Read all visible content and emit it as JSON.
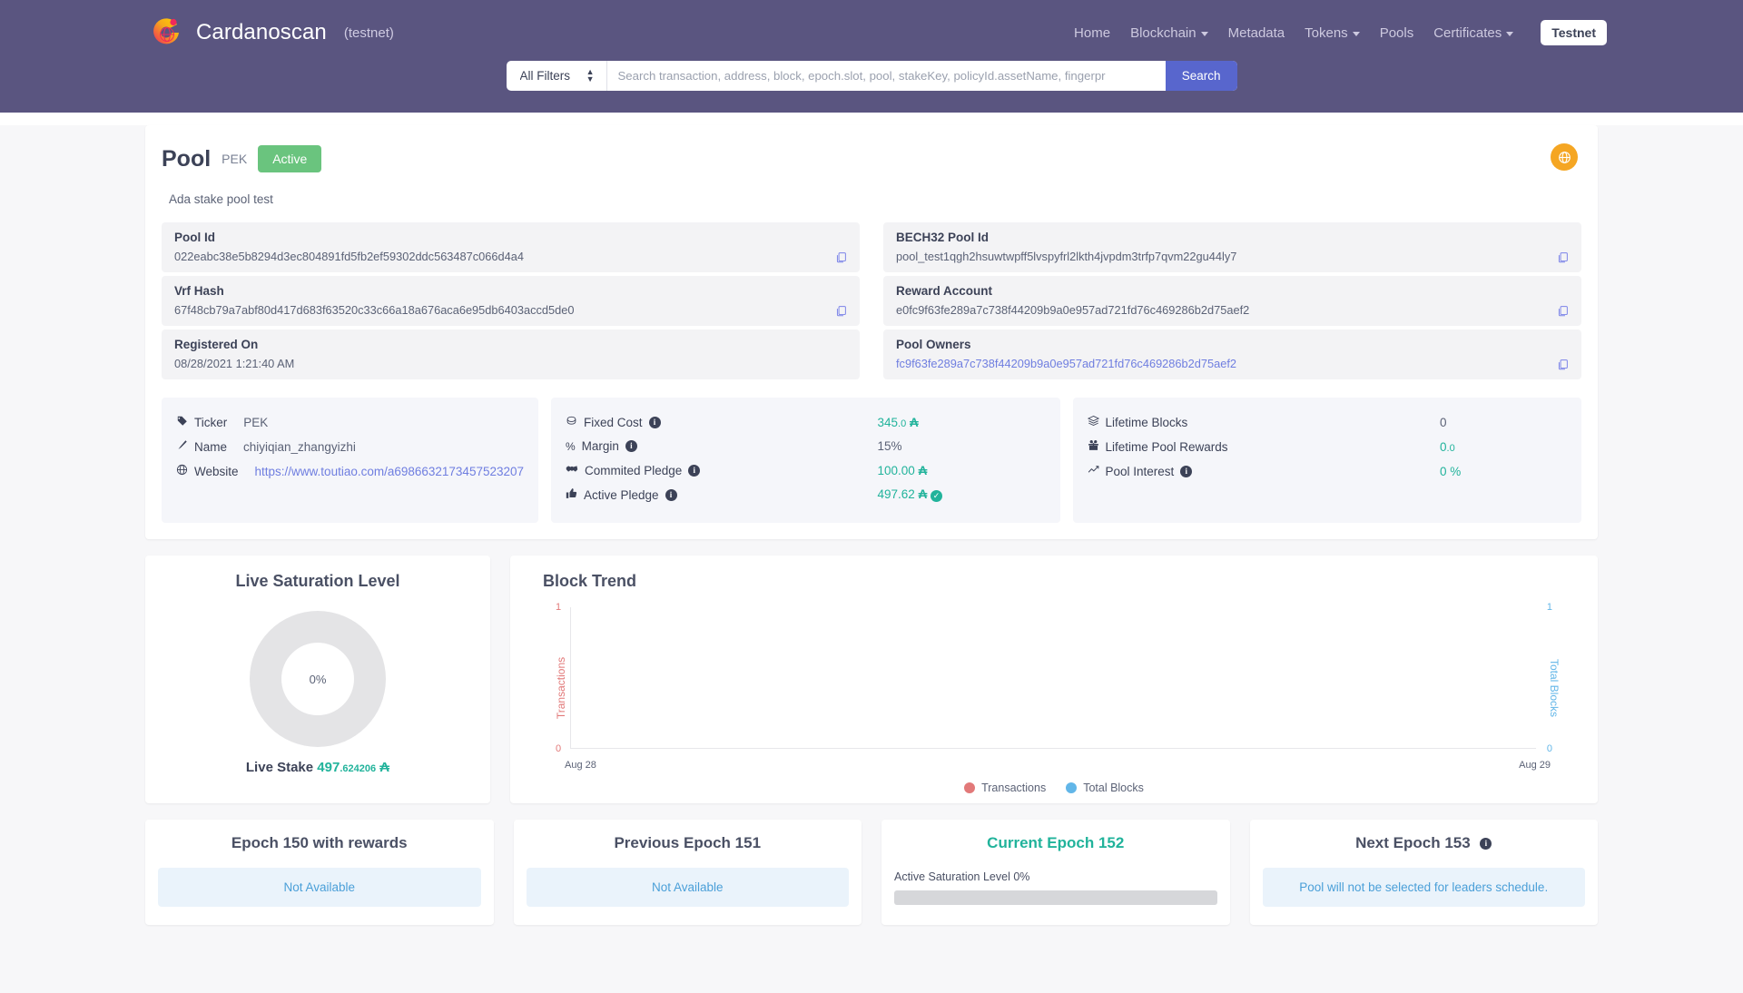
{
  "header": {
    "brand": "Cardanoscan",
    "brand_sub": "(testnet)",
    "nav": [
      {
        "label": "Home",
        "caret": false
      },
      {
        "label": "Blockchain",
        "caret": true
      },
      {
        "label": "Metadata",
        "caret": false
      },
      {
        "label": "Tokens",
        "caret": true
      },
      {
        "label": "Pools",
        "caret": false
      },
      {
        "label": "Certificates",
        "caret": true
      }
    ],
    "network_button": "Testnet"
  },
  "search": {
    "filter_value": "All Filters",
    "placeholder": "Search transaction, address, block, epoch.slot, pool, stakeKey, policyId.assetName, fingerpr",
    "input_value": "",
    "button": "Search"
  },
  "pool": {
    "title": "Pool",
    "ticker_tag": "PEK",
    "status": "Active",
    "description": "Ada stake pool test",
    "fields_left": [
      {
        "label": "Pool Id",
        "value": "022eabc38e5b8294d3ec804891fd5fb2ef59302ddc563487c066d4a4",
        "copy": true,
        "link": false
      },
      {
        "label": "Vrf Hash",
        "value": "67f48cb79a7abf80d417d683f63520c33c66a18a676aca6e95db6403accd5de0",
        "copy": true,
        "link": false
      },
      {
        "label": "Registered On",
        "value": "08/28/2021 1:21:40 AM",
        "copy": false,
        "link": false
      }
    ],
    "fields_right": [
      {
        "label": "BECH32 Pool Id",
        "value": "pool_test1qgh2hsuwtwpff5lvspyfrl2lkth4jvpdm3trfp7qvm22gu44ly7",
        "copy": true,
        "link": false
      },
      {
        "label": "Reward Account",
        "value": "e0fc9f63fe289a7c738f44209b9a0e957ad721fd76c469286b2d75aef2",
        "copy": true,
        "link": false
      },
      {
        "label": "Pool Owners",
        "value": "fc9f63fe289a7c738f44209b9a0e957ad721fd76c469286b2d75aef2",
        "copy": true,
        "link": true
      }
    ],
    "panel1": [
      {
        "icon": "tag-icon",
        "label": "Ticker",
        "value": "PEK",
        "link": false
      },
      {
        "icon": "pen-icon",
        "label": "Name",
        "value": "chiyiqian_zhangyizhi",
        "link": false
      },
      {
        "icon": "globe-icon",
        "label": "Website",
        "value": "https://www.toutiao.com/a6986632173457523207",
        "link": true
      }
    ],
    "panel2": [
      {
        "icon": "coin-icon",
        "label": "Fixed Cost",
        "info": true,
        "value": "345",
        "decimal": ".0",
        "ada": true,
        "check": false
      },
      {
        "icon": "percent-icon",
        "label": "Margin",
        "info": true,
        "value": "15%",
        "decimal": "",
        "ada": false,
        "check": false
      },
      {
        "icon": "handshake-icon",
        "label": "Commited Pledge",
        "info": true,
        "value": "100.00",
        "decimal": "",
        "ada": true,
        "check": false
      },
      {
        "icon": "thumbsup-icon",
        "label": "Active Pledge",
        "info": true,
        "value": "497.62",
        "decimal": "",
        "ada": true,
        "check": true
      }
    ],
    "panel3": [
      {
        "icon": "layers-icon",
        "label": "Lifetime Blocks",
        "info": false,
        "value": "0",
        "decimal": "",
        "teal": false
      },
      {
        "icon": "gift-icon",
        "label": "Lifetime Pool Rewards",
        "info": false,
        "value": "0",
        "decimal": ".0",
        "teal": true
      },
      {
        "icon": "chart-icon",
        "label": "Pool Interest",
        "info": true,
        "value": "0 %",
        "decimal": "",
        "teal": true
      }
    ]
  },
  "chart_data": [
    {
      "type": "pie",
      "title": "Live Saturation Level",
      "center_label": "0%",
      "slices": [
        {
          "name": "Saturation",
          "value": 0,
          "color": "#e4e4e6"
        }
      ],
      "footer_label": "Live Stake",
      "footer_value": "497",
      "footer_decimal": ".624206"
    },
    {
      "type": "line",
      "title": "Block Trend",
      "x": [
        "Aug 28",
        "Aug 29"
      ],
      "series": [
        {
          "name": "Transactions",
          "values": [
            0,
            0
          ],
          "color": "#e27979",
          "axis": "left"
        },
        {
          "name": "Total Blocks",
          "values": [
            0,
            0
          ],
          "color": "#62b6e8",
          "axis": "right"
        }
      ],
      "ylabel": "Transactions",
      "ylabel_right": "Total Blocks",
      "ylim": [
        0,
        1
      ],
      "ylim_right": [
        0,
        1
      ],
      "left_ticks": [
        "1",
        "0"
      ],
      "right_ticks": [
        "1",
        "0"
      ],
      "grid": false,
      "legend": "bottom"
    }
  ],
  "epochs": [
    {
      "title": "Epoch 150 with rewards",
      "body": "Not Available",
      "type": "box",
      "info": false
    },
    {
      "title": "Previous Epoch 151",
      "body": "Not Available",
      "type": "box",
      "info": false
    },
    {
      "title": "Current Epoch 152",
      "type": "progress",
      "info": false,
      "current": true,
      "sat_label": "Active Saturation Level 0%",
      "progress": 0
    },
    {
      "title": "Next Epoch 153",
      "body": "Pool will not be selected for leaders schedule.",
      "type": "box",
      "info": true
    }
  ],
  "colors": {
    "navbar": "#5a5580",
    "accent": "#5866cd",
    "active_green": "#6ac47e",
    "teal": "#21b39b",
    "orange": "#f5a623",
    "transactions": "#e27979",
    "total_blocks": "#62b6e8"
  }
}
